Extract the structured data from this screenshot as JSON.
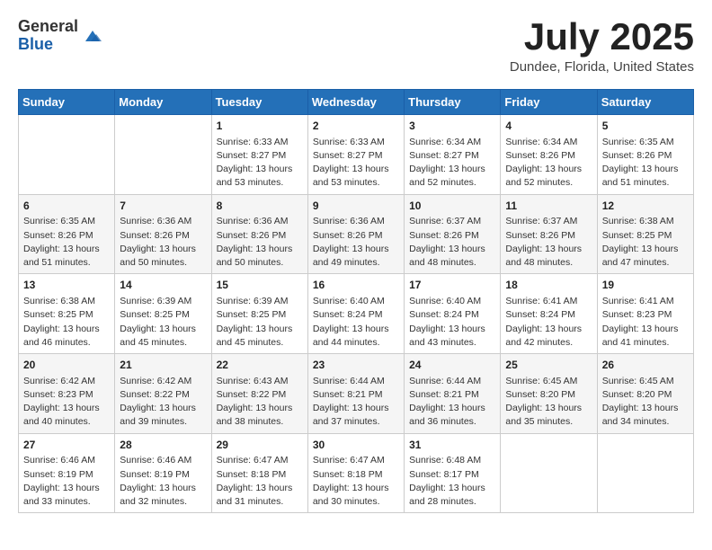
{
  "header": {
    "logo_general": "General",
    "logo_blue": "Blue",
    "month_title": "July 2025",
    "location": "Dundee, Florida, United States"
  },
  "weekdays": [
    "Sunday",
    "Monday",
    "Tuesday",
    "Wednesday",
    "Thursday",
    "Friday",
    "Saturday"
  ],
  "weeks": [
    [
      {
        "day": "",
        "content": ""
      },
      {
        "day": "",
        "content": ""
      },
      {
        "day": "1",
        "content": "Sunrise: 6:33 AM\nSunset: 8:27 PM\nDaylight: 13 hours and 53 minutes."
      },
      {
        "day": "2",
        "content": "Sunrise: 6:33 AM\nSunset: 8:27 PM\nDaylight: 13 hours and 53 minutes."
      },
      {
        "day": "3",
        "content": "Sunrise: 6:34 AM\nSunset: 8:27 PM\nDaylight: 13 hours and 52 minutes."
      },
      {
        "day": "4",
        "content": "Sunrise: 6:34 AM\nSunset: 8:26 PM\nDaylight: 13 hours and 52 minutes."
      },
      {
        "day": "5",
        "content": "Sunrise: 6:35 AM\nSunset: 8:26 PM\nDaylight: 13 hours and 51 minutes."
      }
    ],
    [
      {
        "day": "6",
        "content": "Sunrise: 6:35 AM\nSunset: 8:26 PM\nDaylight: 13 hours and 51 minutes."
      },
      {
        "day": "7",
        "content": "Sunrise: 6:36 AM\nSunset: 8:26 PM\nDaylight: 13 hours and 50 minutes."
      },
      {
        "day": "8",
        "content": "Sunrise: 6:36 AM\nSunset: 8:26 PM\nDaylight: 13 hours and 50 minutes."
      },
      {
        "day": "9",
        "content": "Sunrise: 6:36 AM\nSunset: 8:26 PM\nDaylight: 13 hours and 49 minutes."
      },
      {
        "day": "10",
        "content": "Sunrise: 6:37 AM\nSunset: 8:26 PM\nDaylight: 13 hours and 48 minutes."
      },
      {
        "day": "11",
        "content": "Sunrise: 6:37 AM\nSunset: 8:26 PM\nDaylight: 13 hours and 48 minutes."
      },
      {
        "day": "12",
        "content": "Sunrise: 6:38 AM\nSunset: 8:25 PM\nDaylight: 13 hours and 47 minutes."
      }
    ],
    [
      {
        "day": "13",
        "content": "Sunrise: 6:38 AM\nSunset: 8:25 PM\nDaylight: 13 hours and 46 minutes."
      },
      {
        "day": "14",
        "content": "Sunrise: 6:39 AM\nSunset: 8:25 PM\nDaylight: 13 hours and 45 minutes."
      },
      {
        "day": "15",
        "content": "Sunrise: 6:39 AM\nSunset: 8:25 PM\nDaylight: 13 hours and 45 minutes."
      },
      {
        "day": "16",
        "content": "Sunrise: 6:40 AM\nSunset: 8:24 PM\nDaylight: 13 hours and 44 minutes."
      },
      {
        "day": "17",
        "content": "Sunrise: 6:40 AM\nSunset: 8:24 PM\nDaylight: 13 hours and 43 minutes."
      },
      {
        "day": "18",
        "content": "Sunrise: 6:41 AM\nSunset: 8:24 PM\nDaylight: 13 hours and 42 minutes."
      },
      {
        "day": "19",
        "content": "Sunrise: 6:41 AM\nSunset: 8:23 PM\nDaylight: 13 hours and 41 minutes."
      }
    ],
    [
      {
        "day": "20",
        "content": "Sunrise: 6:42 AM\nSunset: 8:23 PM\nDaylight: 13 hours and 40 minutes."
      },
      {
        "day": "21",
        "content": "Sunrise: 6:42 AM\nSunset: 8:22 PM\nDaylight: 13 hours and 39 minutes."
      },
      {
        "day": "22",
        "content": "Sunrise: 6:43 AM\nSunset: 8:22 PM\nDaylight: 13 hours and 38 minutes."
      },
      {
        "day": "23",
        "content": "Sunrise: 6:44 AM\nSunset: 8:21 PM\nDaylight: 13 hours and 37 minutes."
      },
      {
        "day": "24",
        "content": "Sunrise: 6:44 AM\nSunset: 8:21 PM\nDaylight: 13 hours and 36 minutes."
      },
      {
        "day": "25",
        "content": "Sunrise: 6:45 AM\nSunset: 8:20 PM\nDaylight: 13 hours and 35 minutes."
      },
      {
        "day": "26",
        "content": "Sunrise: 6:45 AM\nSunset: 8:20 PM\nDaylight: 13 hours and 34 minutes."
      }
    ],
    [
      {
        "day": "27",
        "content": "Sunrise: 6:46 AM\nSunset: 8:19 PM\nDaylight: 13 hours and 33 minutes."
      },
      {
        "day": "28",
        "content": "Sunrise: 6:46 AM\nSunset: 8:19 PM\nDaylight: 13 hours and 32 minutes."
      },
      {
        "day": "29",
        "content": "Sunrise: 6:47 AM\nSunset: 8:18 PM\nDaylight: 13 hours and 31 minutes."
      },
      {
        "day": "30",
        "content": "Sunrise: 6:47 AM\nSunset: 8:18 PM\nDaylight: 13 hours and 30 minutes."
      },
      {
        "day": "31",
        "content": "Sunrise: 6:48 AM\nSunset: 8:17 PM\nDaylight: 13 hours and 28 minutes."
      },
      {
        "day": "",
        "content": ""
      },
      {
        "day": "",
        "content": ""
      }
    ]
  ]
}
